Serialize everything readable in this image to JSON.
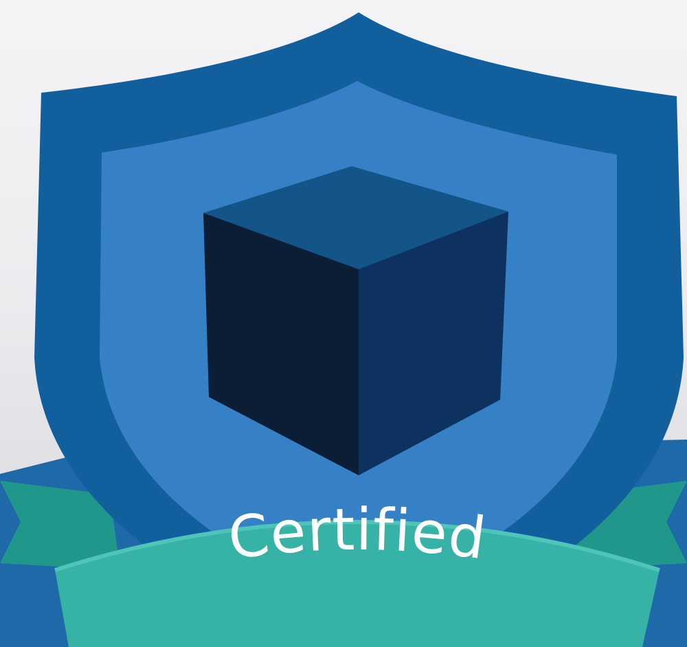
{
  "badge": {
    "ribbon_text": "Certified",
    "emblem_icon": "cube-icon",
    "colors": {
      "shield_outer": "#11609d",
      "shield_inner": "#3680c6",
      "cube_top": "#135489",
      "cube_left": "#0b1e36",
      "cube_right": "#0e3260",
      "ribbon_front": "#37b2a6",
      "ribbon_back": "#1f978b",
      "backdrop_band": "#1e6aa8"
    }
  }
}
